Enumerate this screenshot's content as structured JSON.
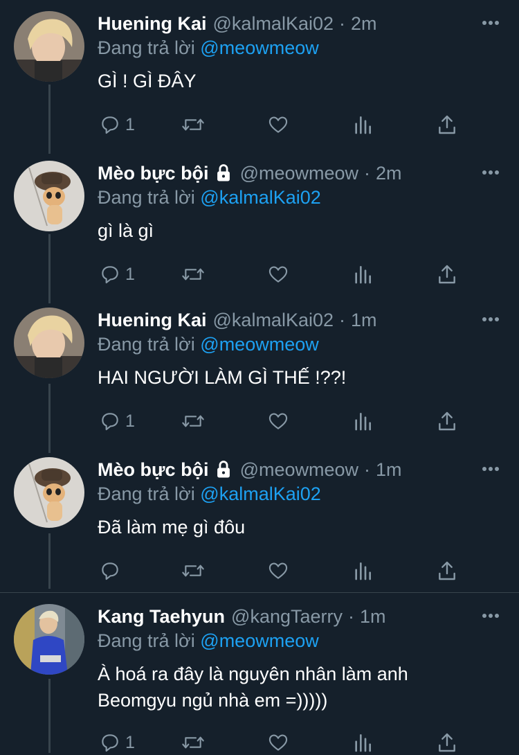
{
  "reply_prefix": "Đang trả lời",
  "colors": {
    "background": "#15202b",
    "text": "#ffffff",
    "muted": "#8899a6",
    "accent": "#1da1f2",
    "border": "#38444d"
  },
  "icons": {
    "reply": "reply-icon",
    "retweet": "retweet-icon",
    "like": "like-icon",
    "analytics": "analytics-icon",
    "share": "share-icon",
    "more": "more-icon",
    "lock": "lock-icon"
  },
  "tweets": [
    {
      "name": "Huening Kai",
      "handle": "@kalmalKai02",
      "sep": "·",
      "time": "2m",
      "locked": false,
      "replying_to": "@meowmeow",
      "text": "GÌ ! GÌ ĐÂY",
      "reply_count": "1",
      "avatar": "blonde-boy-avatar"
    },
    {
      "name": "Mèo bực bội",
      "handle": "@meowmeow",
      "sep": "·",
      "time": "2m",
      "locked": true,
      "replying_to": "@kalmalKai02",
      "text": "gì là gì",
      "reply_count": "1",
      "avatar": "cat-in-hat-avatar"
    },
    {
      "name": "Huening Kai",
      "handle": "@kalmalKai02",
      "sep": "·",
      "time": "1m",
      "locked": false,
      "replying_to": "@meowmeow",
      "text": "HAI NGƯỜI LÀM GÌ THẾ !??!",
      "reply_count": "1",
      "avatar": "blonde-boy-avatar"
    },
    {
      "name": "Mèo bực bội",
      "handle": "@meowmeow",
      "sep": "·",
      "time": "1m",
      "locked": true,
      "replying_to": "@kalmalKai02",
      "text": "Đã làm mẹ gì đôu",
      "reply_count": "",
      "avatar": "cat-in-hat-avatar"
    },
    {
      "name": "Kang Taehyun",
      "handle": "@kangTaerry",
      "sep": "·",
      "time": "1m",
      "locked": false,
      "replying_to": "@meowmeow",
      "text": "À hoá ra đây là nguyên nhân làm anh Beomgyu ngủ nhà em =)))))",
      "reply_count": "1",
      "avatar": "blue-sweater-boy-avatar"
    }
  ]
}
